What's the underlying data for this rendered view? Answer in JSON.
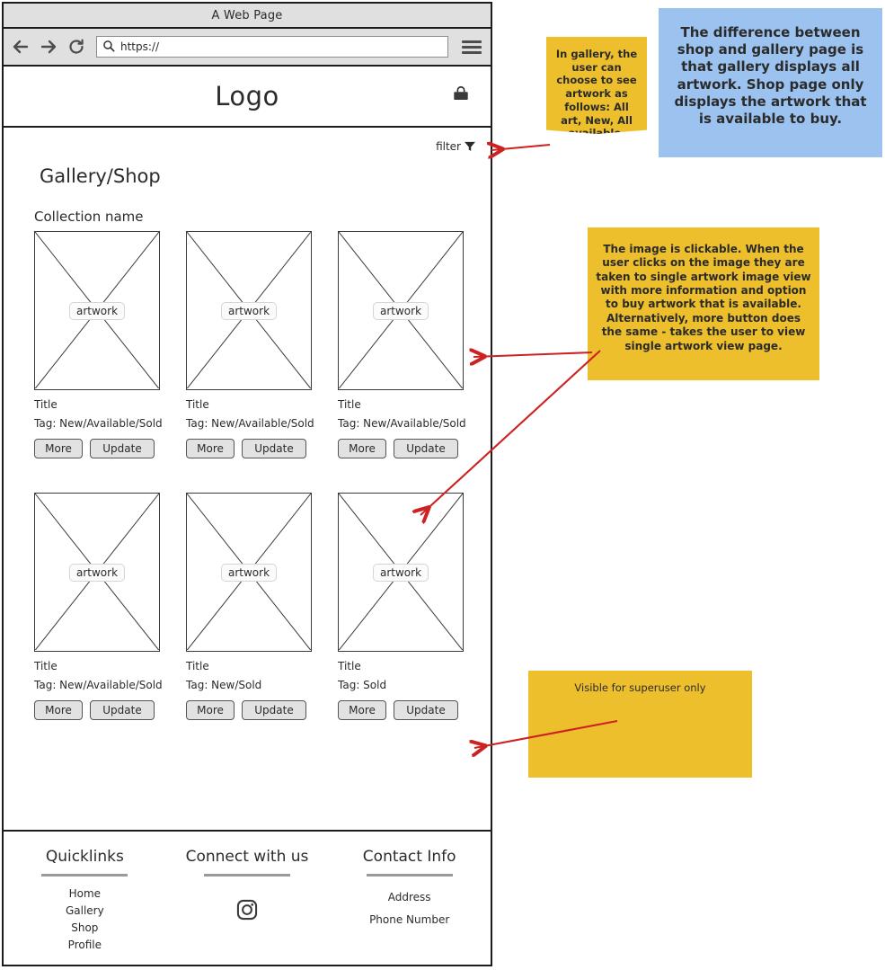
{
  "browser": {
    "window_title": "A Web Page",
    "url_value": "https://",
    "url_placeholder": "https://",
    "back_icon": "arrow-left-icon",
    "forward_icon": "arrow-right-icon",
    "reload_icon": "reload-icon",
    "search_icon": "search-icon",
    "menu_icon": "hamburger-menu-icon"
  },
  "site_header": {
    "logo": "Logo",
    "cart_icon": "shopping-bag-icon"
  },
  "page": {
    "filter_label": "filter",
    "filter_icon": "funnel-filter-icon",
    "title": "Gallery/Shop",
    "collection_name": "Collection name",
    "thumb_placeholder": "artwork",
    "buttons": {
      "more": "More",
      "update": "Update"
    },
    "rows": [
      {
        "cards": [
          {
            "thumb": "artwork",
            "title": "Title",
            "tag": "Tag: New/Available/Sold",
            "more": "More",
            "update": "Update"
          },
          {
            "thumb": "artwork",
            "title": "Title",
            "tag": "Tag: New/Available/Sold",
            "more": "More",
            "update": "Update"
          },
          {
            "thumb": "artwork",
            "title": "Title",
            "tag": "Tag: New/Available/Sold",
            "more": "More",
            "update": "Update"
          }
        ]
      },
      {
        "cards": [
          {
            "thumb": "artwork",
            "title": "Title",
            "tag": "Tag: New/Available/Sold",
            "more": "More",
            "update": "Update"
          },
          {
            "thumb": "artwork",
            "title": "Title",
            "tag": "Tag: New/Sold",
            "more": "More",
            "update": "Update"
          },
          {
            "thumb": "artwork",
            "title": "Title",
            "tag": "Tag: Sold",
            "more": "More",
            "update": "Update"
          }
        ]
      }
    ]
  },
  "footer": {
    "columns": [
      {
        "heading": "Quicklinks",
        "links": [
          "Home",
          "Gallery",
          "Shop",
          "Profile"
        ]
      },
      {
        "heading": "Connect with us",
        "icon": "instagram-icon",
        "links": []
      },
      {
        "heading": "Contact Info",
        "links": [
          "Address",
          "Phone Number"
        ]
      }
    ]
  },
  "notes": [
    {
      "id": "filter-note",
      "color": "#edbf2c",
      "text": "In gallery, the user can choose to see artwork as follows: All art, New, All available, Sold."
    },
    {
      "id": "difference-note",
      "color": "#9cc3f0",
      "text": "The difference between shop and gallery page is that gallery displays all artwork. Shop page only displays the artwork that is available to buy."
    },
    {
      "id": "clickable-note",
      "color": "#edbf2c",
      "text": "The image is clickable. When the user clicks on the image they are taken to single artwork image view with more information and option to buy artwork that is available.  Alternatively, more button does the same - takes the user to view single artwork view page."
    },
    {
      "id": "superuser-note",
      "color": "#edbf2c",
      "text": "Visible for superuser only"
    }
  ],
  "annotation_arrow_color": "#cc2222"
}
